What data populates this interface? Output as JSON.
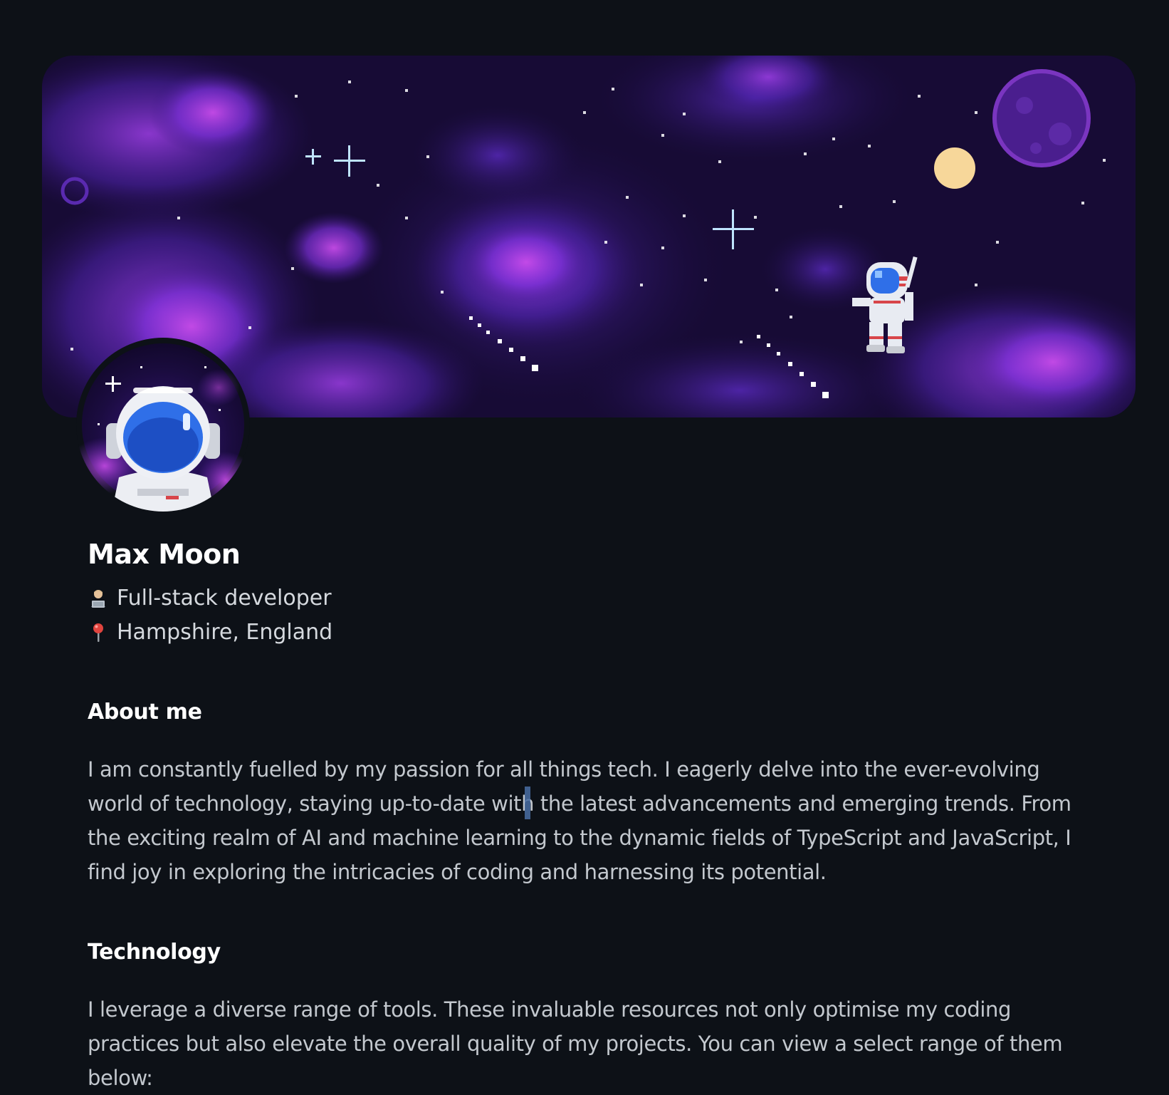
{
  "profile": {
    "name": "Max Moon",
    "role": "Full-stack developer",
    "role_icon": "technologist-emoji-icon",
    "location": "Hampshire, England",
    "location_icon": "round-pushpin-emoji-icon"
  },
  "banner": {
    "description_icon": "pixel-space-astronaut-banner"
  },
  "avatar": {
    "icon": "astronaut-helmet-avatar-icon"
  },
  "sections": {
    "about": {
      "heading": "About me",
      "body": "I am constantly fuelled by my passion for all things tech. I eagerly delve into the ever-evolving world of technology, staying up-to-date with the latest advancements and emerging trends. From the exciting realm of AI and machine learning to the dynamic fields of TypeScript and JavaScript, I find joy in exploring the intricacies of coding and harnessing its potential."
    },
    "technology": {
      "heading": "Technology",
      "body": "I leverage a diverse range of tools. These invaluable resources not only optimise my coding practices but also elevate the overall quality of my projects. You can view a select range of them below:"
    }
  },
  "colors": {
    "page_background": "#0d1117",
    "heading_text": "#ffffff",
    "body_text": "#c3c8ce",
    "space_dark": "#160c33",
    "nebula_purple": "#7b2fd6",
    "nebula_pink": "#c042e8",
    "helmet_blue": "#2f6fe8",
    "moon_yellow": "#f7d79a"
  }
}
